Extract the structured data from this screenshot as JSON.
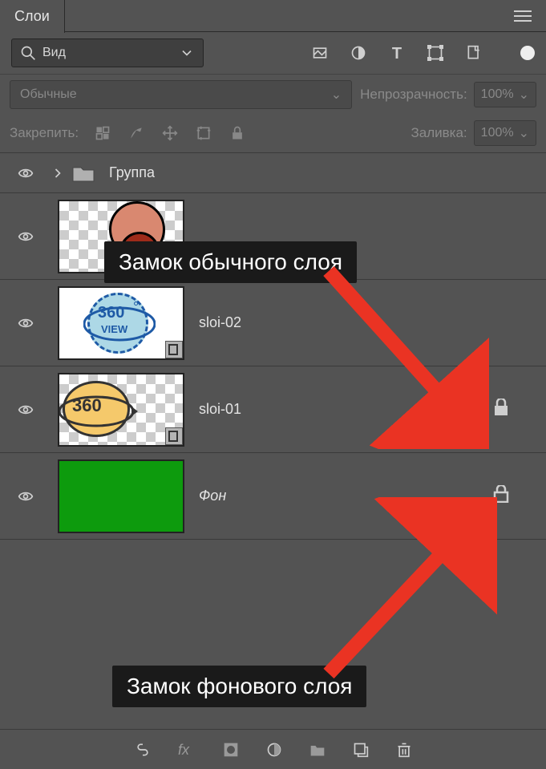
{
  "panel": {
    "tab": "Слои"
  },
  "search": {
    "label": "Вид"
  },
  "blend_mode": "Обычные",
  "opacity": {
    "label": "Непрозрачность:",
    "value": "100%"
  },
  "lock": {
    "label": "Закрепить:"
  },
  "fill": {
    "label": "Заливка:",
    "value": "100%"
  },
  "layers": {
    "group": "Группа",
    "l3": "",
    "l2": "sloi-02",
    "l1": "sloi-01",
    "bg": "Фон"
  },
  "thumb360": {
    "num": "360",
    "deg": "°",
    "view": "VIEW"
  },
  "callouts": {
    "top": "Замок обычного слоя",
    "bottom": "Замок фонового слоя"
  }
}
